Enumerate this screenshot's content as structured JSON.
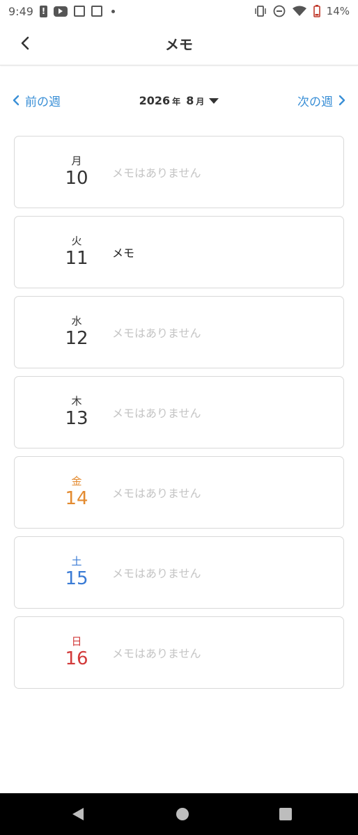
{
  "status_bar": {
    "time": "9:49",
    "battery_percent": "14%",
    "icons": [
      "alert-icon",
      "youtube-icon",
      "news-icon",
      "news-icon",
      "dot-icon",
      "vibrate-icon",
      "dnd-icon",
      "wifi-icon",
      "battery-icon"
    ]
  },
  "app_bar": {
    "title": "メモ",
    "back_icon": "chevron-left-icon"
  },
  "week_nav": {
    "prev_label": "前の週",
    "next_label": "次の週",
    "year": "2026",
    "year_suffix": "年",
    "month": "8",
    "month_suffix": "月"
  },
  "days": [
    {
      "dow": "月",
      "date": "10",
      "memo": "メモはありません",
      "has_memo": false,
      "color": "#333333"
    },
    {
      "dow": "火",
      "date": "11",
      "memo": "メモ",
      "has_memo": true,
      "color": "#333333"
    },
    {
      "dow": "水",
      "date": "12",
      "memo": "メモはありません",
      "has_memo": false,
      "color": "#333333"
    },
    {
      "dow": "木",
      "date": "13",
      "memo": "メモはありません",
      "has_memo": false,
      "color": "#333333"
    },
    {
      "dow": "金",
      "date": "14",
      "memo": "メモはありません",
      "has_memo": false,
      "color": "#e38a2f"
    },
    {
      "dow": "土",
      "date": "15",
      "memo": "メモはありません",
      "has_memo": false,
      "color": "#3a7bd5"
    },
    {
      "dow": "日",
      "date": "16",
      "memo": "メモはありません",
      "has_memo": false,
      "color": "#d23a3a"
    }
  ],
  "colors": {
    "accent": "#3a8fd6",
    "empty_memo": "#c4c4c4",
    "friday": "#e38a2f",
    "saturday": "#3a7bd5",
    "sunday": "#d23a3a"
  }
}
